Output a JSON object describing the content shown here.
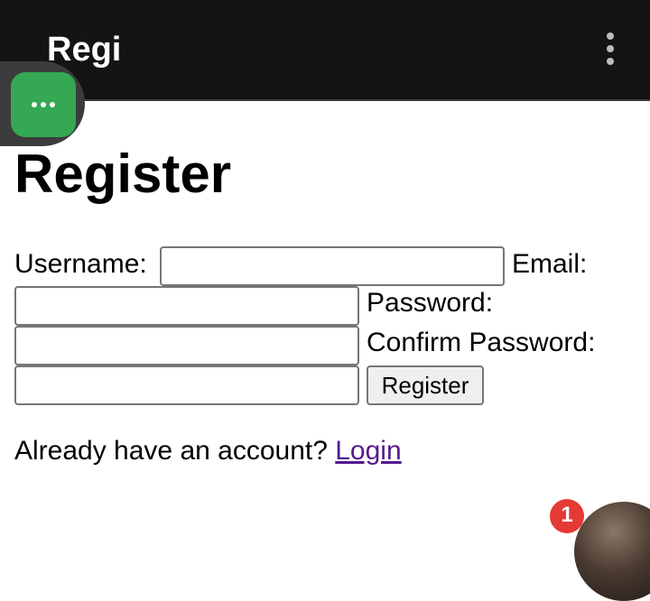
{
  "appbar": {
    "title": "Regi"
  },
  "page": {
    "heading": "Register"
  },
  "form": {
    "username_label": "Username:",
    "email_label": "Email:",
    "password_label": "Password:",
    "confirm_password_label": "Confirm Password:",
    "username_value": "",
    "email_value": "",
    "password_value": "",
    "confirm_password_value": "",
    "submit_label": "Register"
  },
  "footer": {
    "prompt": "Already have an account?",
    "login_link": "Login"
  },
  "notification": {
    "badge_count": "1"
  },
  "icons": {
    "overflow": "more-vert-icon",
    "bubble": "more-horiz-icon"
  },
  "colors": {
    "appbar_bg": "#141414",
    "bubble_green": "#34a853",
    "link": "#551a8b",
    "badge": "#e53935"
  }
}
